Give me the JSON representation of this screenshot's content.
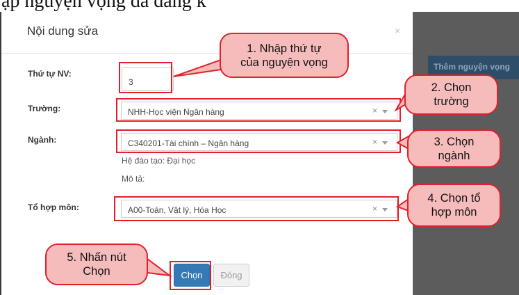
{
  "doc_top_text": "ập nguyện vọng đã đăng k",
  "background": {
    "add_button_label": "Thêm nguyện vọng"
  },
  "modal": {
    "title": "Nội dung sửa",
    "close_glyph": "×",
    "fields": {
      "order": {
        "label": "Thứ tự NV:",
        "value": "3"
      },
      "school": {
        "label": "Trường:",
        "value": "NHH-Học viện Ngân hàng"
      },
      "major": {
        "label": "Ngành:",
        "value": "C340201-Tài chính – Ngân hàng"
      },
      "combo": {
        "label": "Tổ hợp môn:",
        "value": "A00-Toán, Vật lý, Hóa Học"
      }
    },
    "info": {
      "system": "Hệ đào tạo: Đại học",
      "description": "Mô tả:"
    },
    "buttons": {
      "choose": "Chọn",
      "close": "Đóng"
    }
  },
  "callouts": {
    "c1_line1": "1. Nhập thứ tự",
    "c1_line2": "của nguyện vọng",
    "c2_line1": "2. Chọn",
    "c2_line2": "trường",
    "c3_line1": "3. Chọn",
    "c3_line2": "ngành",
    "c4_line1": "4. Chọn tổ",
    "c4_line2": "hợp môn",
    "c5_line1": "5. Nhấn nút",
    "c5_line2": "Chọn"
  },
  "colors": {
    "highlight": "#e2202a",
    "callout_fill": "#f6bcbc",
    "primary_button": "#337ab7"
  }
}
